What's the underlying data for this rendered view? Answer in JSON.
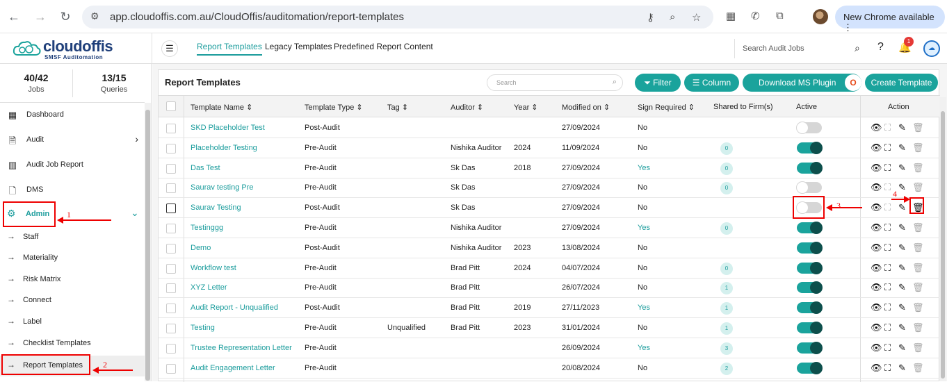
{
  "browser": {
    "url": "app.cloudoffis.com.au/CloudOffis/auditomation/report-templates",
    "update_label": "New Chrome available"
  },
  "header": {
    "logo_text": "cloudoffis",
    "logo_sub": "SMSF Auditomation",
    "tabs": [
      "Report Templates",
      "Legacy Templates",
      "Predefined Report Content"
    ],
    "search_placeholder": "Search Audit Jobs",
    "notification_count": "1"
  },
  "sidebar": {
    "stats": [
      {
        "value": "40/42",
        "label": "Jobs"
      },
      {
        "value": "13/15",
        "label": "Queries"
      }
    ],
    "menu": [
      {
        "label": "Dashboard",
        "icon": "dashboard-icon"
      },
      {
        "label": "Audit",
        "icon": "audit-icon"
      },
      {
        "label": "Audit Job Report",
        "icon": "report-icon"
      },
      {
        "label": "DMS",
        "icon": "document-icon"
      }
    ],
    "admin_label": "Admin",
    "sub_items": [
      "Staff",
      "Materiality",
      "Risk Matrix",
      "Connect",
      "Label",
      "Checklist Templates",
      "Report Templates"
    ]
  },
  "panel": {
    "title": "Report Templates",
    "search_placeholder": "Search",
    "buttons": {
      "filter": "Filter",
      "column": "Column",
      "download": "Download MS Plugin",
      "create": "Create Template"
    }
  },
  "table": {
    "headers": [
      "Template Name",
      "Template Type",
      "Tag",
      "Auditor",
      "Year",
      "Modified on",
      "Sign Required",
      "Shared to Firm(s)",
      "Active",
      "Action"
    ],
    "rows": [
      {
        "name": "SKD Placeholder Test",
        "type": "Post-Audit",
        "tag": "",
        "auditor": "",
        "year": "",
        "modified": "27/09/2024",
        "sign": "No",
        "shared": "",
        "active": false
      },
      {
        "name": "Placeholder Testing",
        "type": "Pre-Audit",
        "tag": "",
        "auditor": "Nishika Auditor",
        "year": "2024",
        "modified": "11/09/2024",
        "sign": "No",
        "shared": "0",
        "active": true
      },
      {
        "name": "Das Test",
        "type": "Pre-Audit",
        "tag": "",
        "auditor": "Sk Das",
        "year": "2018",
        "modified": "27/09/2024",
        "sign": "Yes",
        "shared": "0",
        "active": true
      },
      {
        "name": "Saurav testing Pre",
        "type": "Pre-Audit",
        "tag": "",
        "auditor": "Sk Das",
        "year": "",
        "modified": "27/09/2024",
        "sign": "No",
        "shared": "0",
        "active": false
      },
      {
        "name": "Saurav Testing",
        "type": "Post-Audit",
        "tag": "",
        "auditor": "Sk Das",
        "year": "",
        "modified": "27/09/2024",
        "sign": "No",
        "shared": "",
        "active": false
      },
      {
        "name": "Testinggg",
        "type": "Pre-Audit",
        "tag": "",
        "auditor": "Nishika Auditor",
        "year": "",
        "modified": "27/09/2024",
        "sign": "Yes",
        "shared": "0",
        "active": true
      },
      {
        "name": "Demo",
        "type": "Post-Audit",
        "tag": "",
        "auditor": "Nishika Auditor",
        "year": "2023",
        "modified": "13/08/2024",
        "sign": "No",
        "shared": "",
        "active": true
      },
      {
        "name": "Workflow test",
        "type": "Pre-Audit",
        "tag": "",
        "auditor": "Brad Pitt",
        "year": "2024",
        "modified": "04/07/2024",
        "sign": "No",
        "shared": "0",
        "active": true
      },
      {
        "name": "XYZ Letter",
        "type": "Pre-Audit",
        "tag": "",
        "auditor": "Brad Pitt",
        "year": "",
        "modified": "26/07/2024",
        "sign": "No",
        "shared": "1",
        "active": true
      },
      {
        "name": "Audit Report - Unqualified",
        "type": "Post-Audit",
        "tag": "",
        "auditor": "Brad Pitt",
        "year": "2019",
        "modified": "27/11/2023",
        "sign": "Yes",
        "shared": "1",
        "active": true
      },
      {
        "name": "Testing",
        "type": "Pre-Audit",
        "tag": "Unqualified",
        "auditor": "Brad Pitt",
        "year": "2023",
        "modified": "31/01/2024",
        "sign": "No",
        "shared": "1",
        "active": true
      },
      {
        "name": "Trustee Representation Letter",
        "type": "Pre-Audit",
        "tag": "",
        "auditor": "",
        "year": "",
        "modified": "26/09/2024",
        "sign": "Yes",
        "shared": "3",
        "active": true
      },
      {
        "name": "Audit Engagement Letter",
        "type": "Pre-Audit",
        "tag": "",
        "auditor": "",
        "year": "",
        "modified": "20/08/2024",
        "sign": "No",
        "shared": "2",
        "active": true
      }
    ]
  },
  "annotations": [
    "1",
    "2",
    "3",
    "4"
  ]
}
